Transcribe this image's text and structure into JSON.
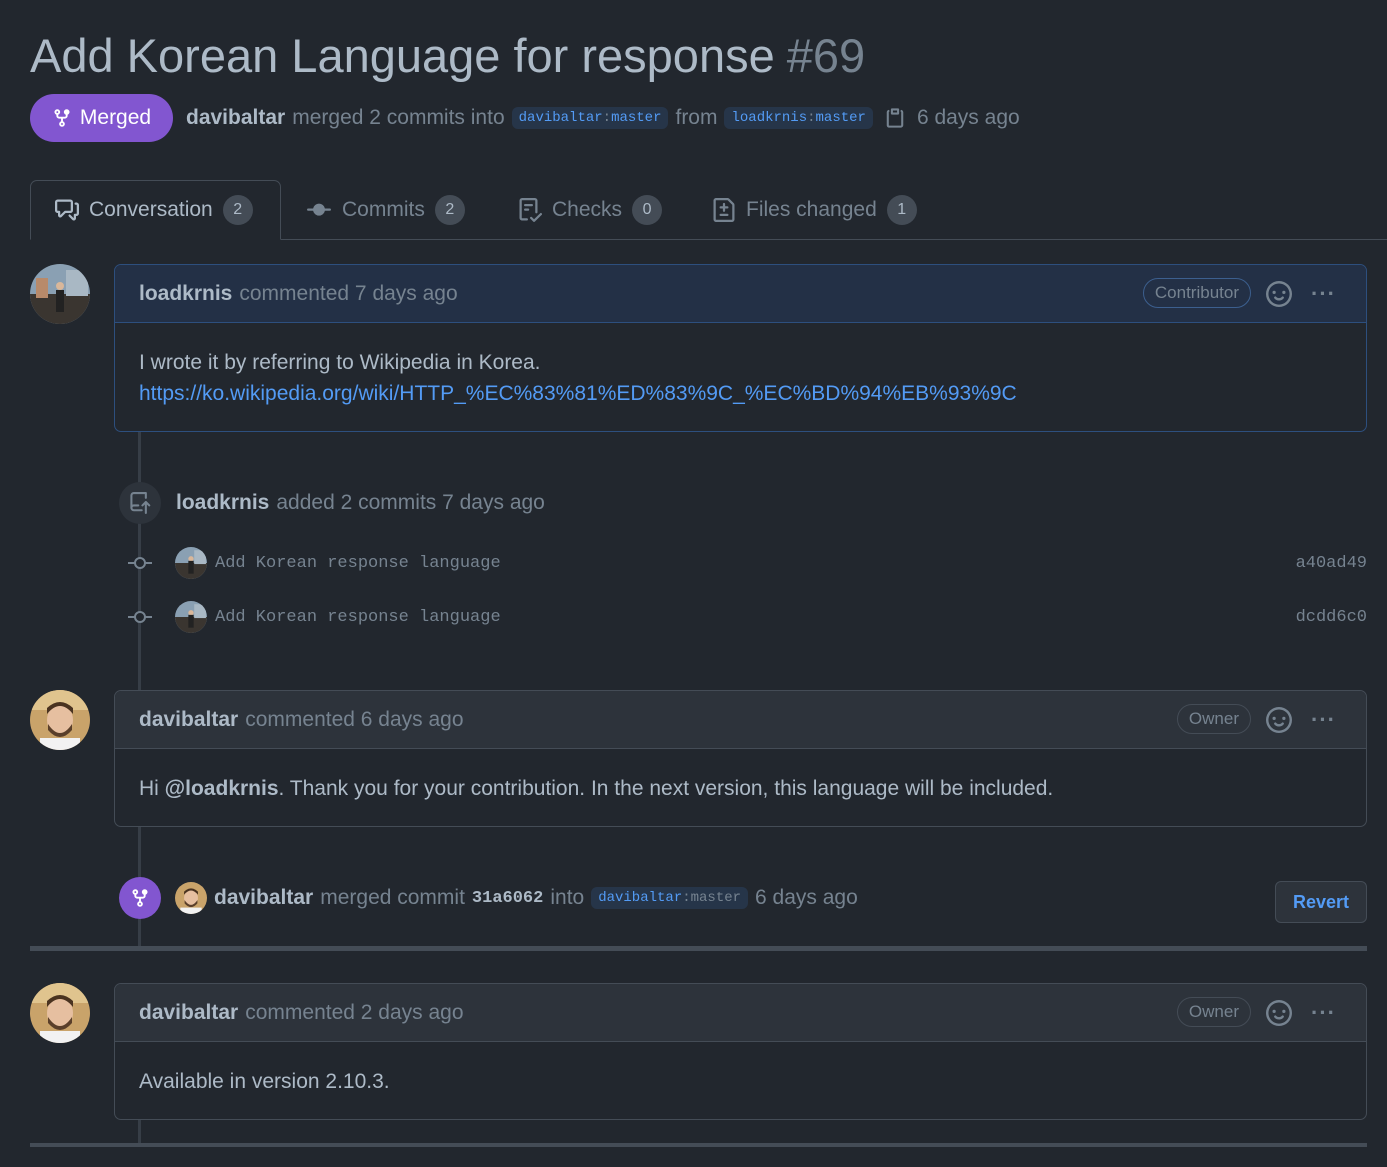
{
  "pr": {
    "title": "Add Korean Language for response",
    "number": "#69",
    "status": "Merged",
    "merger": "davibaltar",
    "merged_text": "merged 2 commits into",
    "base_owner": "davibaltar",
    "base_branch": "master",
    "from_text": "from",
    "head_owner": "loadkrnis",
    "head_branch": "master",
    "time": "6 days ago"
  },
  "tabs": [
    {
      "label": "Conversation",
      "count": "2",
      "icon": "comment-discussion-icon"
    },
    {
      "label": "Commits",
      "count": "2",
      "icon": "commit-icon"
    },
    {
      "label": "Checks",
      "count": "0",
      "icon": "checklist-icon"
    },
    {
      "label": "Files changed",
      "count": "1",
      "icon": "file-diff-icon"
    }
  ],
  "comments": [
    {
      "user": "loadkrnis",
      "action": "commented 7 days ago",
      "role": "Contributor",
      "text": "I wrote it by referring to Wikipedia in Korea.",
      "link": "https://ko.wikipedia.org/wiki/HTTP_%EC%83%81%ED%83%9C_%EC%BD%94%EB%93%9C"
    },
    {
      "user": "davibaltar",
      "action": "commented 6 days ago",
      "role": "Owner",
      "text_before": "Hi ",
      "mention": "@loadkrnis",
      "text_after": ". Thank you for your contribution. In the next version, this language will be included."
    },
    {
      "user": "davibaltar",
      "action": "commented 2 days ago",
      "role": "Owner",
      "text": "Available in version 2.10.3."
    }
  ],
  "commits_event": {
    "user": "loadkrnis",
    "text": "added 2 commits 7 days ago",
    "commits": [
      {
        "message": "Add Korean response language",
        "sha": "a40ad49"
      },
      {
        "message": "Add Korean response language",
        "sha": "dcdd6c0"
      }
    ]
  },
  "merge_event": {
    "user": "davibaltar",
    "text": "merged commit",
    "sha": "31a6062",
    "into": "into",
    "branch_owner": "davibaltar",
    "branch": "master",
    "time": "6 days ago",
    "revert_label": "Revert"
  },
  "colors": {
    "background": "#22272e",
    "merged": "#8256d0",
    "link": "#539bf5",
    "muted": "#768390",
    "text": "#adbac7"
  }
}
